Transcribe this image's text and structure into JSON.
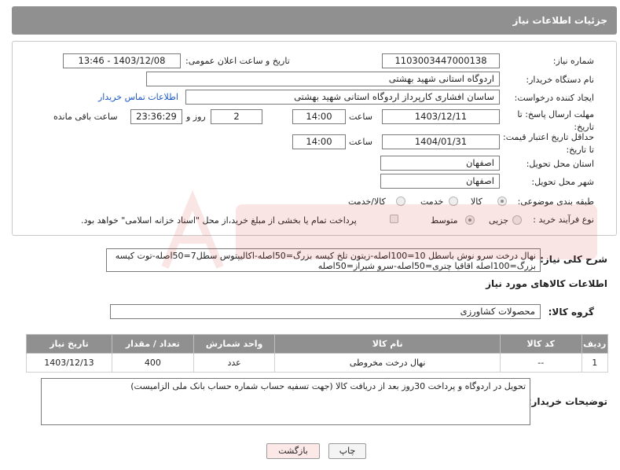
{
  "header": {
    "title": "جزئیات اطلاعات نیاز"
  },
  "form": {
    "need_number_label": "شماره نیاز:",
    "need_number": "1103003447000138",
    "announce_label": "تاریخ و ساعت اعلان عمومی:",
    "announce_value": "1403/12/08 - 13:46",
    "buyer_org_label": "نام دستگاه خریدار:",
    "buyer_org": "اردوگاه استانی شهید بهشتی",
    "creator_label": "ایجاد کننده درخواست:",
    "creator": "ساسان  افشاری کارپرداز اردوگاه استانی شهید بهشتی",
    "contact_link": "اطلاعات تماس خریدار",
    "deadline_label": "مهلت ارسال پاسخ: تا تاریخ:",
    "deadline_date": "1403/12/11",
    "time_label": "ساعت",
    "deadline_time": "14:00",
    "days_value": "2",
    "days_label": "روز و",
    "remaining_time": "23:36:29",
    "remaining_label": "ساعت باقی مانده",
    "validity_label": "حداقل تاریخ اعتبار قیمت: تا تاریخ:",
    "validity_date": "1404/01/31",
    "validity_time": "14:00",
    "province_label": "استان محل تحویل:",
    "province": "اصفهان",
    "city_label": "شهر محل تحویل:",
    "city": "اصفهان",
    "category_label": "طبقه بندی موضوعی:",
    "category_options": [
      "کالا",
      "خدمت",
      "کالا/خدمت"
    ],
    "process_label": "نوع فرآیند خرید :",
    "process_options": [
      "جزیی",
      "متوسط"
    ],
    "payment_note": "پرداخت تمام یا بخشی از مبلغ خرید،از محل \"اسناد خزانه اسلامی\" خواهد بود."
  },
  "summary": {
    "label": "شرح کلی نیاز:",
    "text": "نهال درخت سرو نوش باسطل 10=100اصله-زیتون تلخ کیسه بزرگ=50اصله-اکالیپتوس سطل7=50اصله-توت کیسه بزرگ=100اصله اقاقیا چتری=50اصله-سرو شیراز=50اصله"
  },
  "goods_section": {
    "title": "اطلاعات کالاهای مورد نیاز",
    "group_label": "گروه کالا:",
    "group_value": "محصولات کشاورزی"
  },
  "table": {
    "headers": [
      "ردیف",
      "کد کالا",
      "نام کالا",
      "واحد شمارش",
      "تعداد / مقدار",
      "تاریخ نیاز"
    ],
    "rows": [
      [
        "1",
        "--",
        "نهال درخت مخروطی",
        "عدد",
        "400",
        "1403/12/13"
      ]
    ]
  },
  "notes": {
    "label": "توضیحات خریدار:",
    "text": "تحویل در اردوگاه و پرداخت 30روز بعد از دریافت کالا (جهت تسفیه حساب شماره حساب بانک ملی الزامیست)"
  },
  "buttons": {
    "print": "چاپ",
    "back": "بازگشت"
  },
  "colors": {
    "header_bg": "#909090",
    "link": "#1c57c4",
    "back_button_bg": "#fde8e8"
  }
}
